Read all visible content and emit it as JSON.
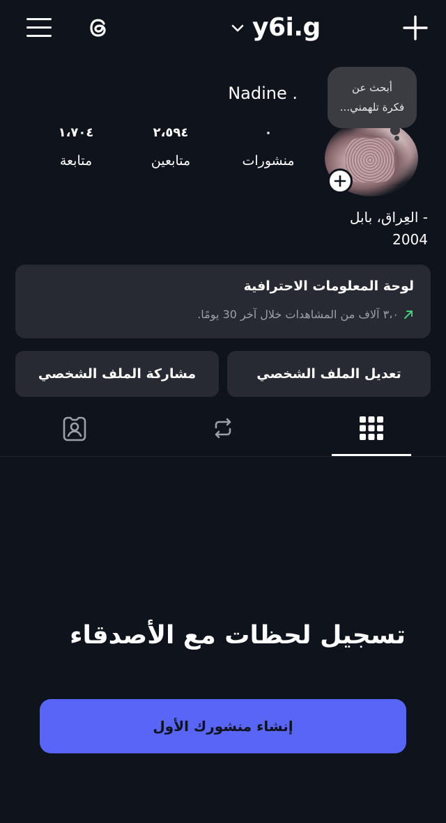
{
  "header": {
    "username": "y6i.g",
    "icons": {
      "menu": "menu-icon",
      "threads": "threads-logo-icon",
      "switch": "chevron-down-icon",
      "create": "plus-icon"
    }
  },
  "profile": {
    "display_name": "Nadine .",
    "note_line1": "أبحث عن",
    "note_line2": "فكرة تلهمني...",
    "stats": {
      "posts_count": "٠",
      "posts_label": "منشورات",
      "followers_count": "٢،٥٩٤",
      "followers_label": "متابعين",
      "following_count": "١،٧٠٤",
      "following_label": "متابعة"
    },
    "bio_line1": "- العِراق، بابل",
    "bio_line2": "2004"
  },
  "dashboard": {
    "title": "لوحة المعلومات الاحترافية",
    "subtitle": "٣،٠ آلاف من المشاهدات خلال آخر 30 يومًا.",
    "trend_color": "#3fd07a"
  },
  "actions": {
    "edit_label": "تعديل الملف الشخصي",
    "share_label": "مشاركة الملف الشخصي"
  },
  "tabs": {
    "active": "posts",
    "icons": [
      "grid-icon",
      "repost-icon",
      "tagged-icon"
    ]
  },
  "empty_state": {
    "title": "تسجيل لحظات مع الأصدقاء",
    "cta_label": "إنشاء منشورك الأول",
    "cta_color": "#5865f7"
  }
}
